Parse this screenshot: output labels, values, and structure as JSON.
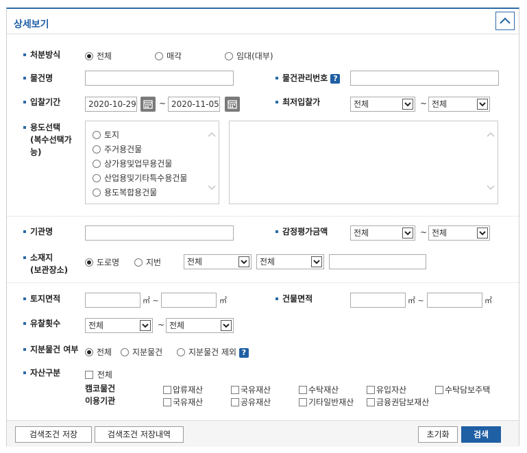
{
  "title": "상세보기",
  "disposal": {
    "label": "처분방식",
    "options": [
      "전체",
      "매각",
      "임대(대부)"
    ],
    "selected": "전체"
  },
  "item_name": {
    "label": "물건명",
    "value": ""
  },
  "item_mgmt_no": {
    "label": "물건관리번호",
    "help": "?",
    "value": ""
  },
  "bid_period": {
    "label": "입찰기간",
    "from": "2020-10-29",
    "to": "2020-11-05",
    "sep": "~"
  },
  "min_bid": {
    "label": "최저입찰가",
    "from": "전체",
    "to": "전체",
    "sep": "~"
  },
  "usage": {
    "label_lines": [
      "용도선택",
      "(복수선택가",
      "능)"
    ],
    "options": [
      "토지",
      "주거용건물",
      "상가용및업무용건물",
      "산업용및기타특수용건물",
      "용도복합용건물"
    ]
  },
  "agency": {
    "label": "기관명",
    "value": ""
  },
  "appraisal": {
    "label": "감정평가금액",
    "from": "전체",
    "to": "전체",
    "sep": "~"
  },
  "location": {
    "label_lines": [
      "소재지",
      "(보관장소)"
    ],
    "options": [
      "도로명",
      "지번"
    ],
    "selected": "도로명",
    "sel1": "전체",
    "sel2": "전체",
    "detail": ""
  },
  "land_area": {
    "label": "토지면적",
    "unit": "㎡",
    "sep": "~"
  },
  "bldg_area": {
    "label": "건물면적",
    "unit": "㎡",
    "sep": "~"
  },
  "fail_count": {
    "label": "유찰횟수",
    "from": "전체",
    "to": "전체",
    "sep": "~"
  },
  "share": {
    "label": "지분물건 여부",
    "options": [
      "전체",
      "지분물건",
      "지분물건 제외"
    ],
    "selected": "전체",
    "help": "?"
  },
  "asset": {
    "label": "자산구분",
    "all": "전체",
    "row1_label": "캠코물건",
    "row1": [
      "압류재산",
      "국유재산",
      "수탁재산",
      "유입자산",
      "수탁담보주택"
    ],
    "row2_label": "이용기관",
    "row2": [
      "국유재산",
      "공유재산",
      "기타일반재산",
      "금융권담보재산"
    ]
  },
  "footer": {
    "save": "검색조건 저장",
    "history": "검색조건 저장내역",
    "reset": "초기화",
    "search": "검색"
  },
  "colors": {
    "accent": "#1f5fa4"
  }
}
